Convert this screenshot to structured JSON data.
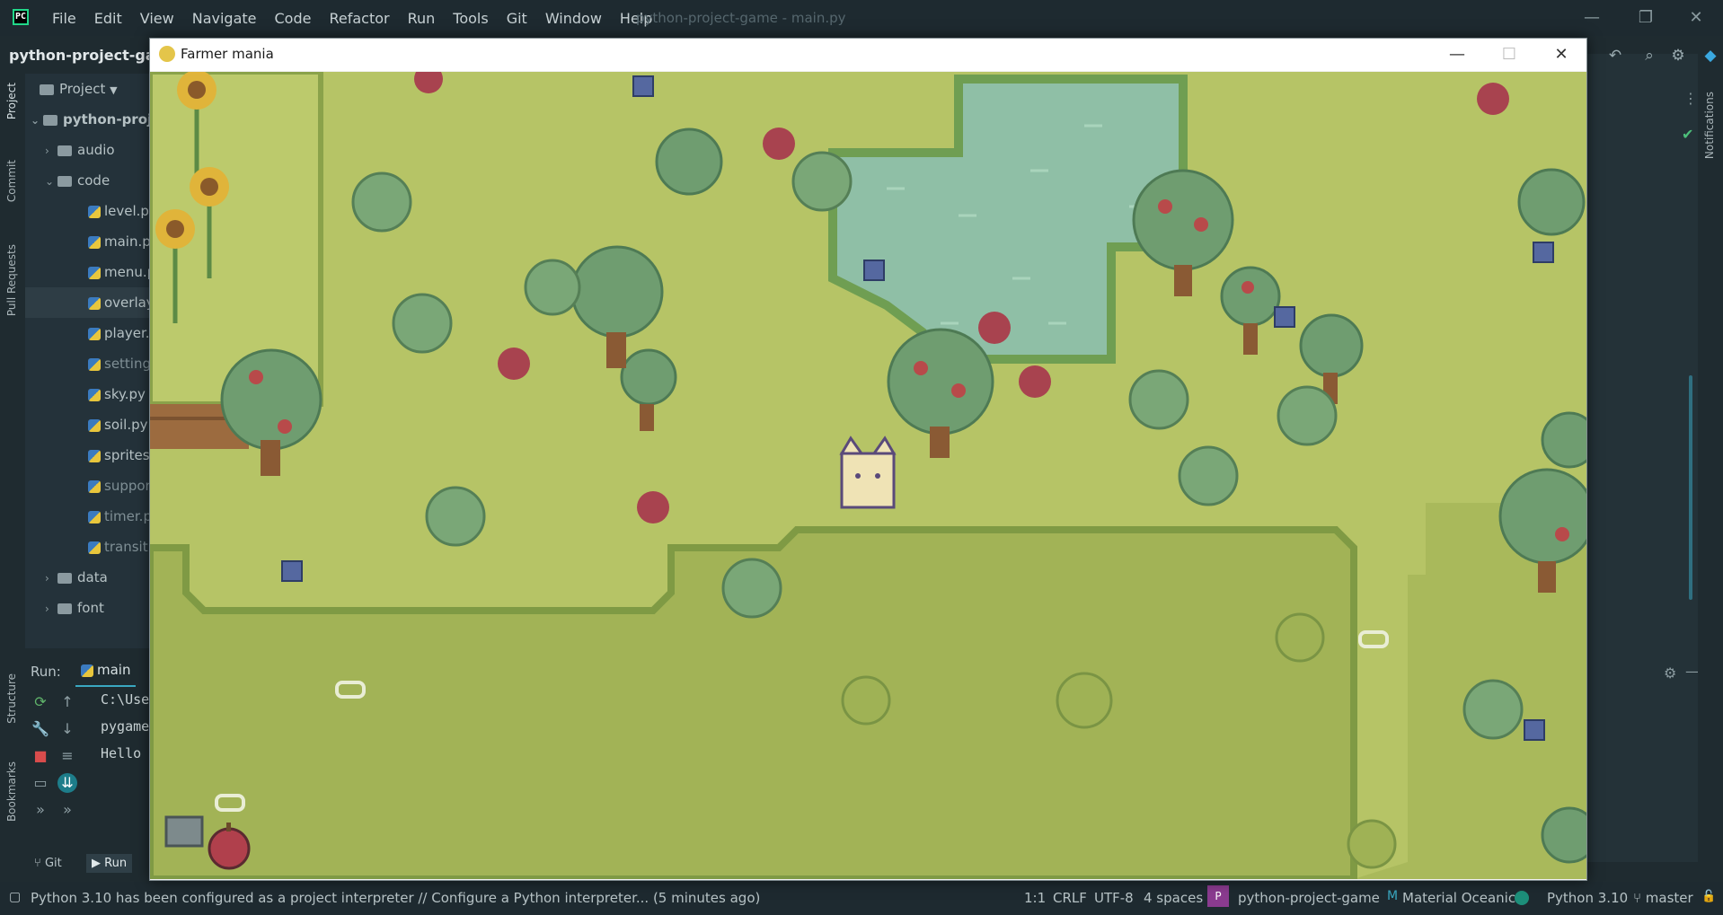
{
  "ide": {
    "logo_text": "PC",
    "menu": [
      "File",
      "Edit",
      "View",
      "Navigate",
      "Code",
      "Refactor",
      "Run",
      "Tools",
      "Git",
      "Window",
      "Help"
    ],
    "window_title": "python-project-game - main.py",
    "project_name": "python-project-game",
    "window_controls": {
      "minimize": "—",
      "restore": "❐",
      "close": "✕"
    }
  },
  "left_strip": {
    "project": "Project",
    "commit": "Commit",
    "pull_requests": "Pull Requests",
    "structure": "Structure",
    "bookmarks": "Bookmarks"
  },
  "project_panel": {
    "header": "Project",
    "tree": [
      {
        "label": "python-proje",
        "kind": "root"
      },
      {
        "label": "audio",
        "kind": "folder"
      },
      {
        "label": "code",
        "kind": "folder-open"
      },
      {
        "label": "level.py",
        "kind": "py"
      },
      {
        "label": "main.py",
        "kind": "py"
      },
      {
        "label": "menu.py",
        "kind": "py"
      },
      {
        "label": "overlay",
        "kind": "py"
      },
      {
        "label": "player.py",
        "kind": "py"
      },
      {
        "label": "settings",
        "kind": "py"
      },
      {
        "label": "sky.py",
        "kind": "py"
      },
      {
        "label": "soil.py",
        "kind": "py"
      },
      {
        "label": "sprites.",
        "kind": "py"
      },
      {
        "label": "support",
        "kind": "py"
      },
      {
        "label": "timer.py",
        "kind": "py"
      },
      {
        "label": "transiti",
        "kind": "py"
      },
      {
        "label": "data",
        "kind": "folder"
      },
      {
        "label": "font",
        "kind": "folder"
      }
    ]
  },
  "run_panel": {
    "label": "Run:",
    "tab": "main",
    "console": [
      "C:\\Use",
      "pygame",
      "Hello"
    ]
  },
  "bottom_tabs": {
    "git": "Git",
    "run": "Run"
  },
  "right_strip": {
    "notifications": "Notifications"
  },
  "game_window": {
    "title": "Farmer mania",
    "controls": {
      "minimize": "—",
      "maximize": "☐",
      "close": "✕"
    }
  },
  "status_bar": {
    "message": "Python 3.10 has been configured as a project interpreter // Configure a Python interpreter... (5 minutes ago)",
    "position": "1:1",
    "line_sep": "CRLF",
    "encoding": "UTF-8",
    "indent": "4 spaces",
    "project": "python-project-game",
    "theme": "Material Oceanic",
    "interpreter": "Python 3.10",
    "branch": "master"
  },
  "colors": {
    "ide_bg": "#1f2b30",
    "grass": "#a8b85a",
    "water": "#8ec0a6",
    "tree": "#7aa176"
  }
}
